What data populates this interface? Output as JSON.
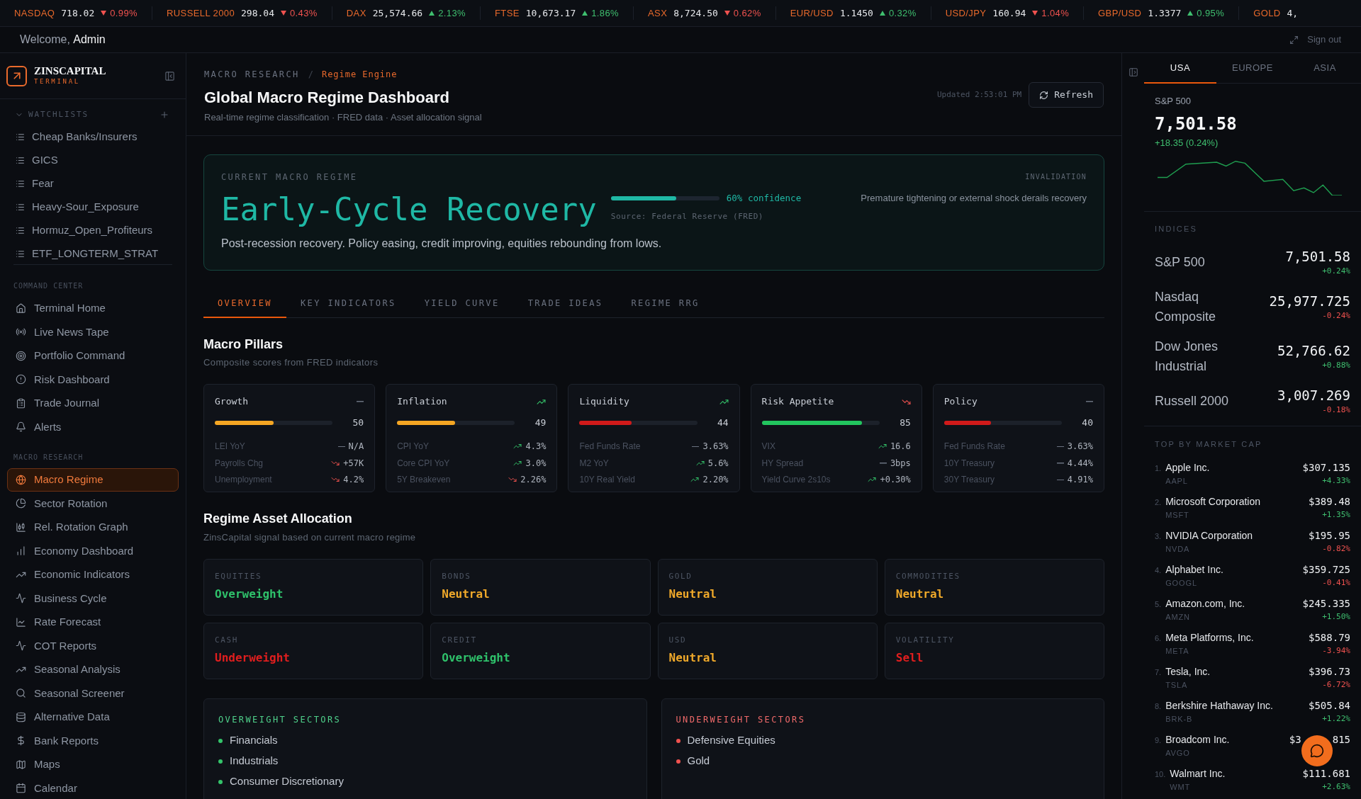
{
  "ticker": [
    {
      "symbol": "NASDAQ",
      "price": "718.02",
      "change": "0.99%",
      "rising": false
    },
    {
      "symbol": "RUSSELL 2000",
      "price": "298.04",
      "change": "0.43%",
      "rising": false
    },
    {
      "symbol": "DAX",
      "price": "25,574.66",
      "change": "2.13%",
      "rising": true
    },
    {
      "symbol": "FTSE",
      "price": "10,673.17",
      "change": "1.86%",
      "rising": true
    },
    {
      "symbol": "ASX",
      "price": "8,724.50",
      "change": "0.62%",
      "rising": false
    },
    {
      "symbol": "EUR/USD",
      "price": "1.1450",
      "change": "0.32%",
      "rising": true
    },
    {
      "symbol": "USD/JPY",
      "price": "160.94",
      "change": "1.04%",
      "rising": false
    },
    {
      "symbol": "GBP/USD",
      "price": "1.3377",
      "change": "0.95%",
      "rising": true
    },
    {
      "symbol": "GOLD",
      "price": "4,"
    }
  ],
  "header": {
    "greeting": "Welcome,",
    "user": "Admin",
    "sign_out": "Sign out"
  },
  "sidebar": {
    "brand": "ZINSCAPITAL",
    "brand_sub": "TERMINAL",
    "watchlists": {
      "title": "WATCHLISTS",
      "expanded": true,
      "items": [
        "Cheap Banks/Insurers",
        "GICS",
        "Fear",
        "Heavy-Sour_Exposure",
        "Hormuz_Open_Profiteurs",
        "ETF_LONGTERM_STRAT"
      ]
    },
    "sections": [
      {
        "title": "COMMAND CENTER",
        "items": [
          {
            "label": "Terminal Home",
            "selected": false
          },
          {
            "label": "Live News Tape",
            "selected": false
          },
          {
            "label": "Portfolio Command",
            "selected": false
          },
          {
            "label": "Risk Dashboard",
            "selected": false
          },
          {
            "label": "Trade Journal",
            "selected": false
          },
          {
            "label": "Alerts",
            "selected": false
          }
        ]
      },
      {
        "title": "MACRO RESEARCH",
        "items": [
          {
            "label": "Macro Regime",
            "selected": true
          },
          {
            "label": "Sector Rotation",
            "selected": false
          },
          {
            "label": "Rel. Rotation Graph",
            "selected": false
          },
          {
            "label": "Economy Dashboard",
            "selected": false
          },
          {
            "label": "Economic Indicators",
            "selected": false
          },
          {
            "label": "Business Cycle",
            "selected": false
          },
          {
            "label": "Rate Forecast",
            "selected": false
          },
          {
            "label": "COT Reports",
            "selected": false
          },
          {
            "label": "Seasonal Analysis",
            "selected": false
          },
          {
            "label": "Seasonal Screener",
            "selected": false
          },
          {
            "label": "Alternative Data",
            "selected": false
          },
          {
            "label": "Bank Reports",
            "selected": false
          },
          {
            "label": "Maps",
            "selected": false
          },
          {
            "label": "Calendar",
            "selected": false
          }
        ]
      }
    ]
  },
  "page": {
    "breadcrumb": {
      "items": [
        "MACRO RESEARCH",
        "Regime Engine"
      ],
      "separator": "/"
    },
    "title": "Global Macro Regime Dashboard",
    "subtitle": "Real-time regime classification · FRED data · Asset allocation signal",
    "updated": "Updated 2:53:01 PM",
    "refresh": "Refresh"
  },
  "regime": {
    "label": "CURRENT MACRO REGIME",
    "name": "Early-Cycle Recovery",
    "level": 0.6,
    "confidence": "60% confidence",
    "source": "Source: Federal Reserve (FRED)",
    "invalidation_label": "INVALIDATION",
    "invalidation": "Premature tightening or external shock derails recovery",
    "description": "Post-recession recovery. Policy easing, credit improving, equities rebounding from lows."
  },
  "tabs": [
    {
      "label": "OVERVIEW",
      "selected": true
    },
    {
      "label": "KEY INDICATORS",
      "selected": false
    },
    {
      "label": "YIELD CURVE",
      "selected": false
    },
    {
      "label": "TRADE IDEAS",
      "selected": false
    },
    {
      "label": "REGIME RRG",
      "selected": false
    }
  ],
  "pillars": {
    "title": "Macro Pillars",
    "subtitle": "Composite scores from FRED indicators",
    "items": [
      {
        "name": "Growth",
        "kind": "flat",
        "score": "50",
        "level": 0.5,
        "color": "#f5a623",
        "indicators": [
          {
            "name": "LEI YoY",
            "kind": "flat",
            "value": "N/A"
          },
          {
            "name": "Payrolls Chg",
            "kind": "falling",
            "value": "+57K"
          },
          {
            "name": "Unemployment",
            "kind": "falling",
            "value": "4.2%"
          }
        ]
      },
      {
        "name": "Inflation",
        "kind": "rising",
        "score": "49",
        "level": 0.49,
        "color": "#f5a623",
        "indicators": [
          {
            "name": "CPI YoY",
            "kind": "rising",
            "value": "4.3%"
          },
          {
            "name": "Core CPI YoY",
            "kind": "rising",
            "value": "3.0%"
          },
          {
            "name": "5Y Breakeven",
            "kind": "falling",
            "value": "2.26%"
          }
        ]
      },
      {
        "name": "Liquidity",
        "kind": "rising",
        "score": "44",
        "level": 0.44,
        "color": "#d11a1a",
        "indicators": [
          {
            "name": "Fed Funds Rate",
            "kind": "flat",
            "value": "3.63%"
          },
          {
            "name": "M2 YoY",
            "kind": "rising",
            "value": "5.6%"
          },
          {
            "name": "10Y Real Yield",
            "kind": "rising",
            "value": "2.20%"
          }
        ]
      },
      {
        "name": "Risk Appetite",
        "kind": "falling",
        "score": "85",
        "level": 0.85,
        "color": "#22c55e",
        "indicators": [
          {
            "name": "VIX",
            "kind": "rising",
            "value": "16.6"
          },
          {
            "name": "HY Spread",
            "kind": "flat",
            "value": "3bps"
          },
          {
            "name": "Yield Curve 2s10s",
            "kind": "rising",
            "value": "+0.30%"
          }
        ]
      },
      {
        "name": "Policy",
        "kind": "flat",
        "score": "40",
        "level": 0.4,
        "color": "#d11a1a",
        "indicators": [
          {
            "name": "Fed Funds Rate",
            "kind": "flat",
            "value": "3.63%"
          },
          {
            "name": "10Y Treasury",
            "kind": "flat",
            "value": "4.44%"
          },
          {
            "name": "30Y Treasury",
            "kind": "flat",
            "value": "4.91%"
          }
        ]
      }
    ]
  },
  "allocation": {
    "title": "Regime Asset Allocation",
    "subtitle": "ZinsCapital signal based on current macro regime",
    "items": [
      {
        "asset": "EQUITIES",
        "signal": "Overweight",
        "kind": "positive"
      },
      {
        "asset": "BONDS",
        "signal": "Neutral",
        "kind": "neutral"
      },
      {
        "asset": "GOLD",
        "signal": "Neutral",
        "kind": "neutral"
      },
      {
        "asset": "COMMODITIES",
        "signal": "Neutral",
        "kind": "neutral"
      },
      {
        "asset": "CASH",
        "signal": "Underweight",
        "kind": "negative"
      },
      {
        "asset": "CREDIT",
        "signal": "Overweight",
        "kind": "positive"
      },
      {
        "asset": "USD",
        "signal": "Neutral",
        "kind": "neutral"
      },
      {
        "asset": "VOLATILITY",
        "signal": "Sell",
        "kind": "negative"
      }
    ]
  },
  "sectors": [
    {
      "title": "OVERWEIGHT SECTORS",
      "kind": "positive",
      "items": [
        "Financials",
        "Industrials",
        "Consumer Discretionary"
      ]
    },
    {
      "title": "UNDERWEIGHT SECTORS",
      "kind": "negative",
      "items": [
        "Defensive Equities",
        "Gold"
      ]
    }
  ],
  "market": {
    "tabs": [
      {
        "label": "USA",
        "selected": true
      },
      {
        "label": "EUROPE",
        "selected": false
      },
      {
        "label": "ASIA",
        "selected": false
      }
    ],
    "featured": {
      "name": "S&P 500",
      "value": "7,501.58",
      "change": "+18.35 (0.24%)",
      "rising": true
    },
    "indices": {
      "title": "INDICES",
      "items": [
        {
          "name": "S&P 500",
          "value": "7,501.58",
          "change": "+0.24%",
          "rising": true
        },
        {
          "name": "Nasdaq Composite",
          "value": "25,977.725",
          "change": "-0.24%",
          "rising": false
        },
        {
          "name": "Dow Jones Industrial",
          "value": "52,766.62",
          "change": "+0.88%",
          "rising": true
        },
        {
          "name": "Russell 2000",
          "value": "3,007.269",
          "change": "-0.18%",
          "rising": false
        }
      ]
    },
    "top": {
      "title": "TOP BY MARKET CAP",
      "items": [
        {
          "rank": "1.",
          "name": "Apple Inc.",
          "ticker": "AAPL",
          "price": "$307.135",
          "change": "+4.33%",
          "rising": true
        },
        {
          "rank": "2.",
          "name": "Microsoft Corporation",
          "ticker": "MSFT",
          "price": "$389.48",
          "change": "+1.35%",
          "rising": true
        },
        {
          "rank": "3.",
          "name": "NVIDIA Corporation",
          "ticker": "NVDA",
          "price": "$195.95",
          "change": "-0.82%",
          "rising": false
        },
        {
          "rank": "4.",
          "name": "Alphabet Inc.",
          "ticker": "GOOGL",
          "price": "$359.725",
          "change": "-0.41%",
          "rising": false
        },
        {
          "rank": "5.",
          "name": "Amazon.com, Inc.",
          "ticker": "AMZN",
          "price": "$245.335",
          "change": "+1.50%",
          "rising": true
        },
        {
          "rank": "6.",
          "name": "Meta Platforms, Inc.",
          "ticker": "META",
          "price": "$588.79",
          "change": "-3.94%",
          "rising": false
        },
        {
          "rank": "7.",
          "name": "Tesla, Inc.",
          "ticker": "TSLA",
          "price": "$396.73",
          "change": "-6.72%",
          "rising": false
        },
        {
          "rank": "8.",
          "name": "Berkshire Hathaway Inc.",
          "ticker": "BRK-B",
          "price": "$505.84",
          "change": "+1.22%",
          "rising": true
        },
        {
          "rank": "9.",
          "name": "Broadcom Inc.",
          "ticker": "AVGO",
          "price_parts": [
            "$3",
            "815"
          ]
        },
        {
          "rank": "10.",
          "name": "Walmart Inc.",
          "ticker": "WMT",
          "price": "$111.681",
          "change": "+2.63%",
          "rising": true
        }
      ]
    }
  }
}
